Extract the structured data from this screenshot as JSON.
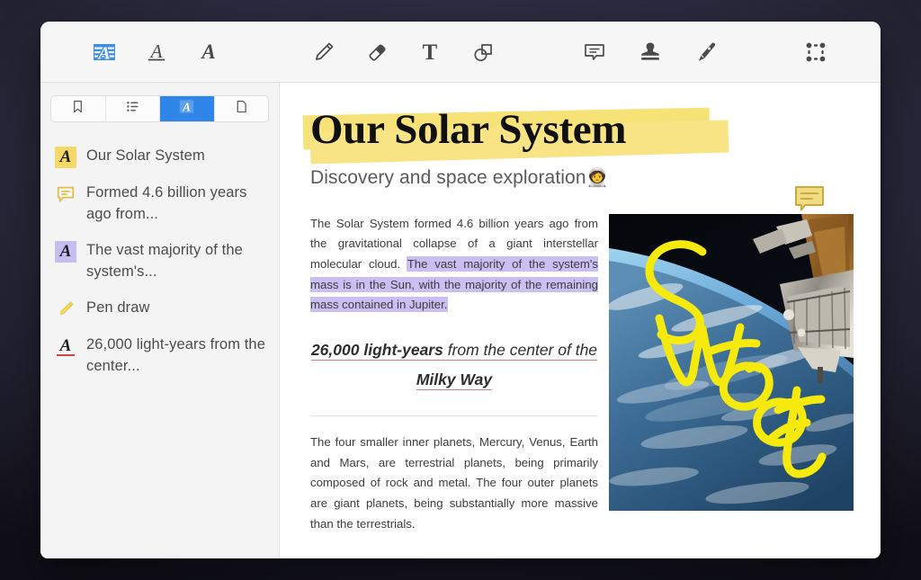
{
  "toolbar": {
    "groups": [
      {
        "name": "markup-group",
        "tools": [
          {
            "id": "highlight",
            "label": "Highlight text",
            "icon": "highlight-icon",
            "active": true
          },
          {
            "id": "underline",
            "label": "Underline text",
            "icon": "underline-icon",
            "active": false
          },
          {
            "id": "strikeout",
            "label": "Strikeout text",
            "icon": "strikeout-icon",
            "active": false
          }
        ]
      },
      {
        "name": "draw-group",
        "tools": [
          {
            "id": "pencil",
            "label": "Pencil",
            "icon": "pencil-icon",
            "active": false
          },
          {
            "id": "eraser",
            "label": "Eraser",
            "icon": "eraser-icon",
            "active": false
          },
          {
            "id": "text",
            "label": "Text box",
            "icon": "text-icon",
            "active": false
          },
          {
            "id": "shapes",
            "label": "Shapes",
            "icon": "shapes-icon",
            "active": false
          }
        ]
      },
      {
        "name": "insert-group",
        "tools": [
          {
            "id": "comment",
            "label": "Comment",
            "icon": "comment-icon",
            "active": false
          },
          {
            "id": "stamp",
            "label": "Stamp",
            "icon": "stamp-icon",
            "active": false
          },
          {
            "id": "signature",
            "label": "Signature",
            "icon": "signature-pen-icon",
            "active": false
          }
        ]
      },
      {
        "name": "select-group",
        "tools": [
          {
            "id": "area-select",
            "label": "Area select",
            "icon": "area-select-icon",
            "active": false
          }
        ]
      }
    ],
    "accent_color": "#2f86e8"
  },
  "sidebar": {
    "tabs": [
      {
        "id": "bookmarks",
        "label": "Bookmarks",
        "icon": "bookmark-icon",
        "active": false
      },
      {
        "id": "outline",
        "label": "Outline",
        "icon": "list-icon",
        "active": false
      },
      {
        "id": "annotations",
        "label": "Annotations",
        "icon": "annotation-a-icon",
        "active": true
      },
      {
        "id": "pages",
        "label": "Pages",
        "icon": "page-icon",
        "active": false
      }
    ],
    "annotations": [
      {
        "text": "Our Solar System",
        "icon": "highlight-a-icon",
        "icon_style": "highlight-yellow",
        "color": "#f5d967"
      },
      {
        "text": "Formed 4.6 billion years ago from...",
        "icon": "comment-icon",
        "icon_style": "comment-yellow",
        "color": "#e6c84e"
      },
      {
        "text": "The vast majority of the system's...",
        "icon": "highlight-a-icon",
        "icon_style": "highlight-purple",
        "color": "#c6bdf0"
      },
      {
        "text": "Pen draw",
        "icon": "pencil-icon",
        "icon_style": "pencil-yellow",
        "color": "#f2d64f"
      },
      {
        "text": "26,000 light-years from the center...",
        "icon": "underline-a-icon",
        "icon_style": "underline-red",
        "color": "#d64545"
      }
    ]
  },
  "document": {
    "title": "Our Solar System",
    "subtitle": "Discovery and space exploration",
    "subtitle_emoji": "🧑‍🚀",
    "title_highlight_color": "#f7e277",
    "paragraph1_plain": "The Solar System formed 4.6 billion years ago from the gravitational collapse of a giant interstellar molecular cloud. ",
    "paragraph1_highlighted": "The vast majority of the system's mass is in the Sun, with the majority of the remaining mass contained in Jupiter.",
    "paragraph1_highlight_color": "#c9bff2",
    "pull_quote_bold1": "26,000 light-years",
    "pull_quote_mid": " from the center of the ",
    "pull_quote_bold2": "Milky Way",
    "pull_quote_underline_color": "#d97b78",
    "paragraph2": "The four smaller inner planets, Mercury, Venus, Earth and Mars, are terrestrial planets, being primarily composed of rock and metal. The four outer planets are giant planets, being substantially more massive than the terrestrials.",
    "image_alt": "Earth seen from orbit with spacecraft module",
    "pen_annotation_text": "Sweet",
    "pen_annotation_color": "#f5e90d",
    "comment_marker_color": "#e6c84e"
  }
}
